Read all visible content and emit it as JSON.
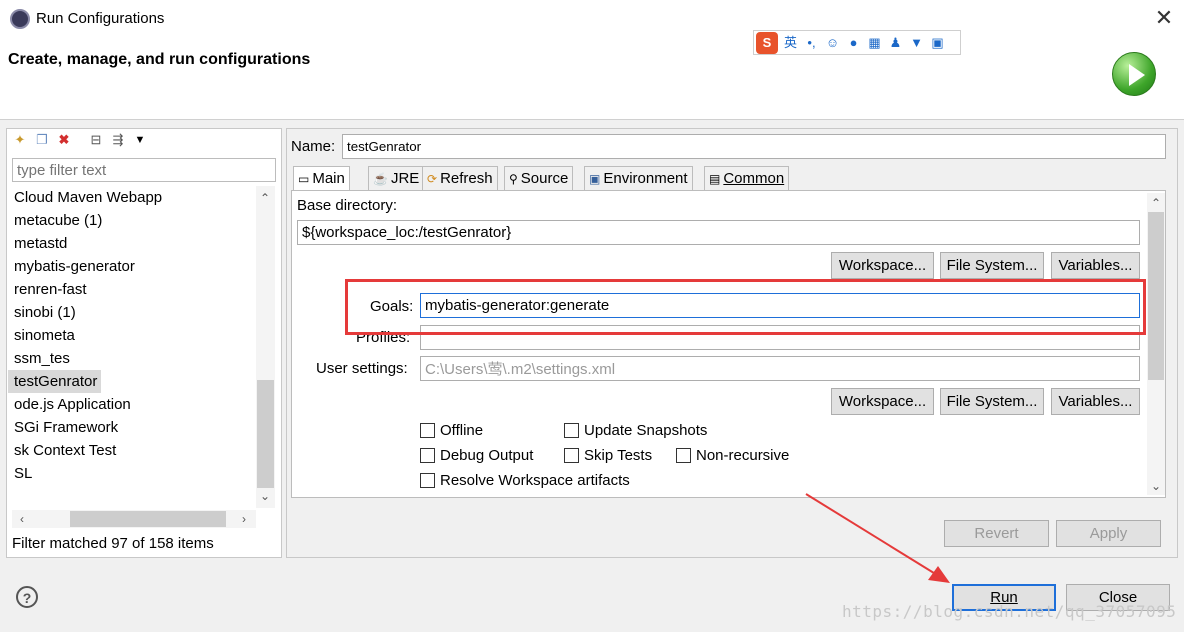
{
  "window": {
    "title": "Run Configurations",
    "header_title": "Create, manage, and run configurations",
    "close_label": "✕",
    "ime_label": "英",
    "ime_logo": "S"
  },
  "left": {
    "filter_placeholder": "type filter text",
    "items": [
      "Cloud Maven Webapp",
      "metacube (1)",
      "metastd",
      "mybatis-generator",
      "renren-fast",
      "sinobi (1)",
      "sinometa",
      "ssm_tes",
      "testGenrator",
      "ode.js Application",
      "SGi Framework",
      "sk Context Test",
      "SL"
    ],
    "selected_index": 8,
    "status": "Filter matched 97 of 158 items"
  },
  "right": {
    "name_label": "Name:",
    "name_value": "testGenrator",
    "tabs": [
      "Main",
      "JRE",
      "Refresh",
      "Source",
      "Environment",
      "Common"
    ],
    "base_dir_label": "Base directory:",
    "base_dir_value": "${workspace_loc:/testGenrator}",
    "workspace_btn": "Workspace...",
    "filesystem_btn": "File System...",
    "variables_btn": "Variables...",
    "goals_label": "Goals:",
    "goals_value": "mybatis-generator:generate",
    "profiles_label": "Profiles:",
    "profiles_value": "",
    "user_settings_label": "User settings:",
    "user_settings_value": "C:\\Users\\莺\\.m2\\settings.xml",
    "checkboxes": {
      "offline": "Offline",
      "update_snapshots": "Update Snapshots",
      "debug_output": "Debug Output",
      "skip_tests": "Skip Tests",
      "non_recursive": "Non-recursive",
      "resolve_workspace": "Resolve Workspace artifacts"
    },
    "revert_btn": "Revert",
    "apply_btn": "Apply"
  },
  "footer": {
    "help": "?",
    "run_btn": "Run",
    "close_btn": "Close",
    "watermark": "https://blog.csdn.net/qq_37057095"
  },
  "colors": {
    "highlight": "#e53a3a",
    "selection": "#d9d9d9",
    "focus": "#1e6fd9"
  }
}
